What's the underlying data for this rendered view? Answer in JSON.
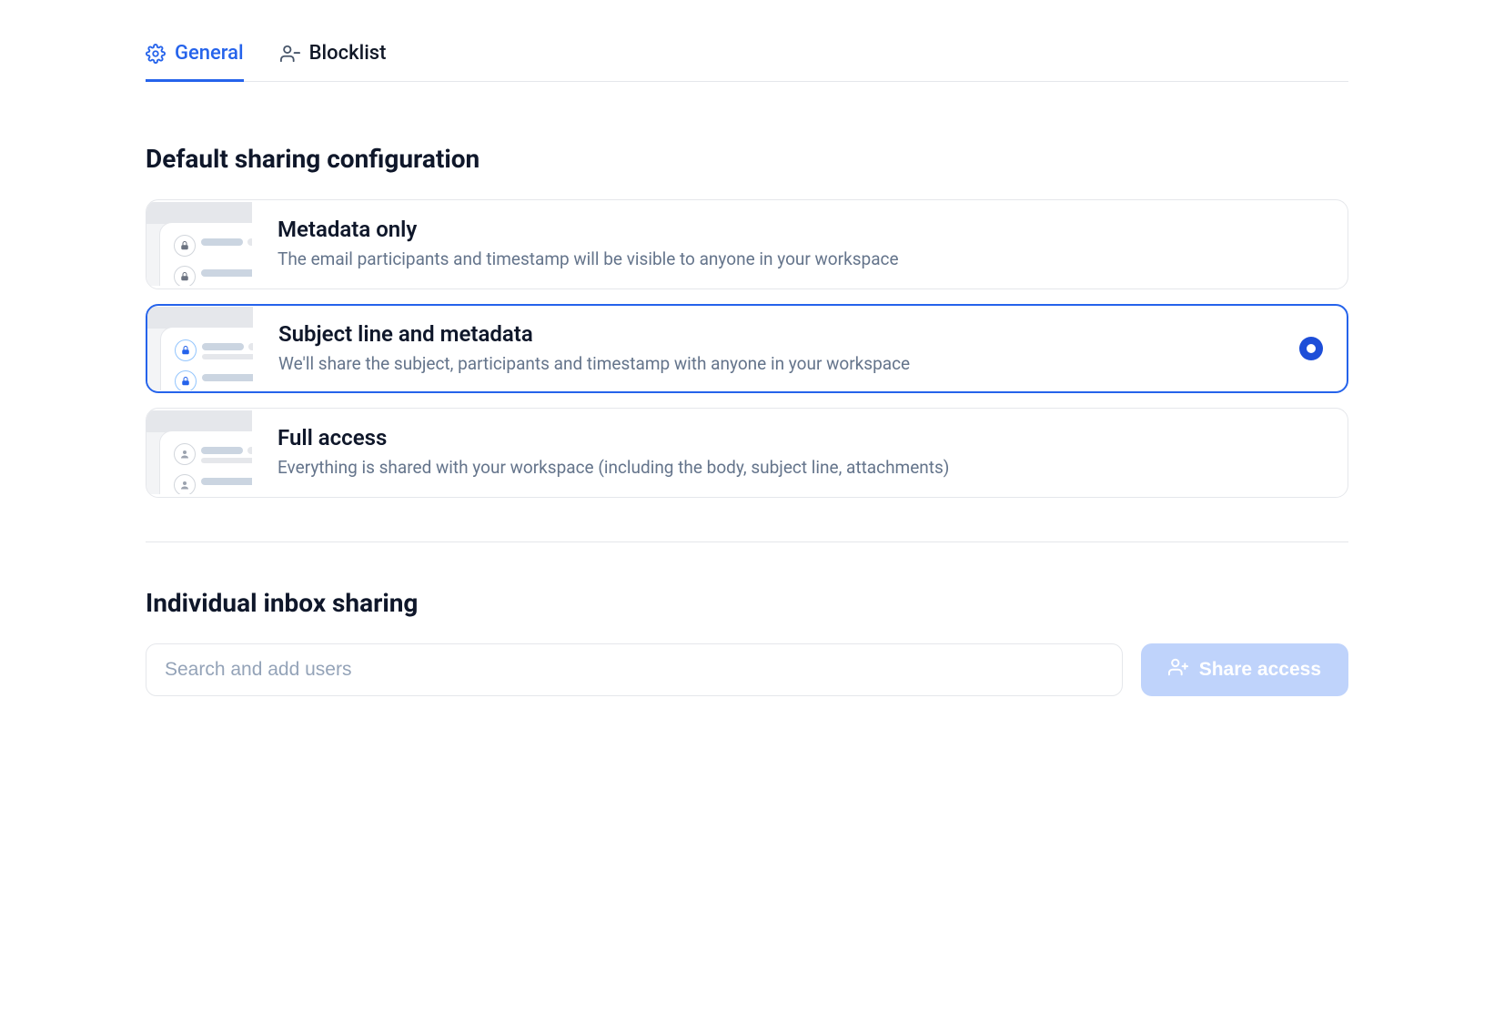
{
  "tabs": [
    {
      "label": "General",
      "icon": "gear-icon",
      "active": true
    },
    {
      "label": "Blocklist",
      "icon": "user-minus-icon",
      "active": false
    }
  ],
  "sections": {
    "sharing_heading": "Default sharing configuration",
    "individual_heading": "Individual inbox sharing"
  },
  "options": [
    {
      "id": "metadata-only",
      "title": "Metadata only",
      "description": "The email participants and timestamp will be visible to anyone in your workspace",
      "icon": "lock",
      "icon_color": "#6b7280",
      "selected": false
    },
    {
      "id": "subject-metadata",
      "title": "Subject line and metadata",
      "description": "We'll share the subject, participants and timestamp with anyone in your workspace",
      "icon": "lock",
      "icon_color": "#2563eb",
      "selected": true
    },
    {
      "id": "full-access",
      "title": "Full access",
      "description": "Everything is shared with your workspace (including the body, subject line, attachments)",
      "icon": "user",
      "icon_color": "#9ca3af",
      "selected": false
    }
  ],
  "search": {
    "placeholder": "Search and add users",
    "value": ""
  },
  "share_button": {
    "label": "Share access"
  },
  "colors": {
    "accent": "#2563eb"
  }
}
